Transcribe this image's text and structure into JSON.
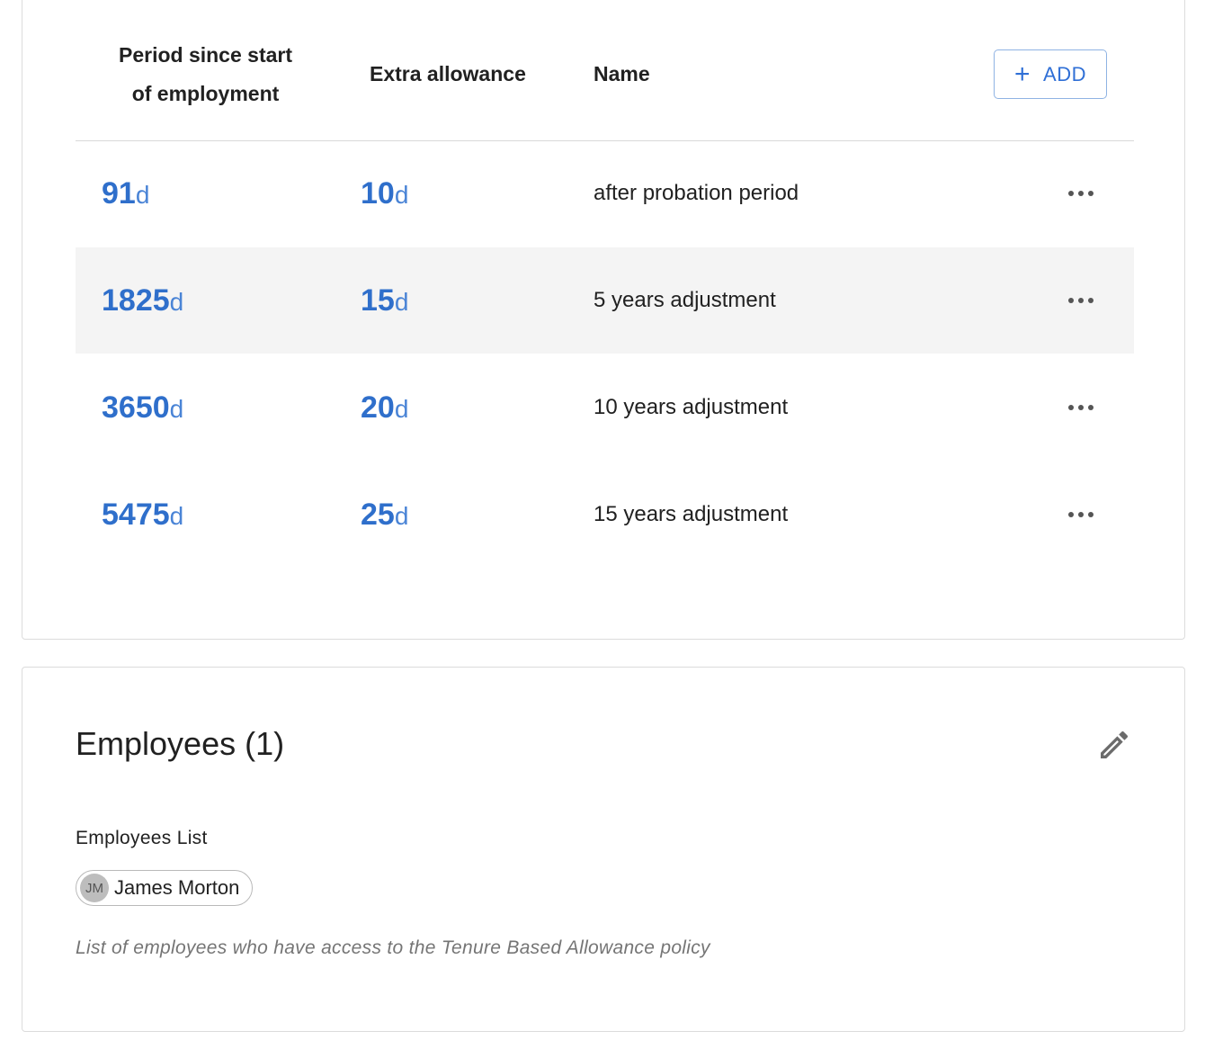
{
  "table": {
    "headers": {
      "period_line1": "Period since start",
      "period_line2": "of employment",
      "extra": "Extra allowance",
      "name": "Name"
    },
    "add_button": {
      "icon": "plus-icon",
      "label": "ADD"
    },
    "unit": "d",
    "rows": [
      {
        "period": "91",
        "extra": "10",
        "name": "after probation period"
      },
      {
        "period": "1825",
        "extra": "15",
        "name": "5 years adjustment"
      },
      {
        "period": "3650",
        "extra": "20",
        "name": "10 years adjustment"
      },
      {
        "period": "5475",
        "extra": "25",
        "name": "15 years adjustment"
      }
    ],
    "row_menu_icon": "more-horizontal-icon"
  },
  "employees": {
    "title": "Employees (1)",
    "edit_icon": "pencil-icon",
    "list_label": "Employees List",
    "chips": [
      {
        "initials": "JM",
        "name": "James Morton"
      }
    ],
    "helper_text": "List of employees who have access to the Tenure Based Allowance policy"
  },
  "colors": {
    "accent": "#2f6fcb",
    "row_highlight": "#f4f4f4",
    "border": "#dcdcdc"
  }
}
